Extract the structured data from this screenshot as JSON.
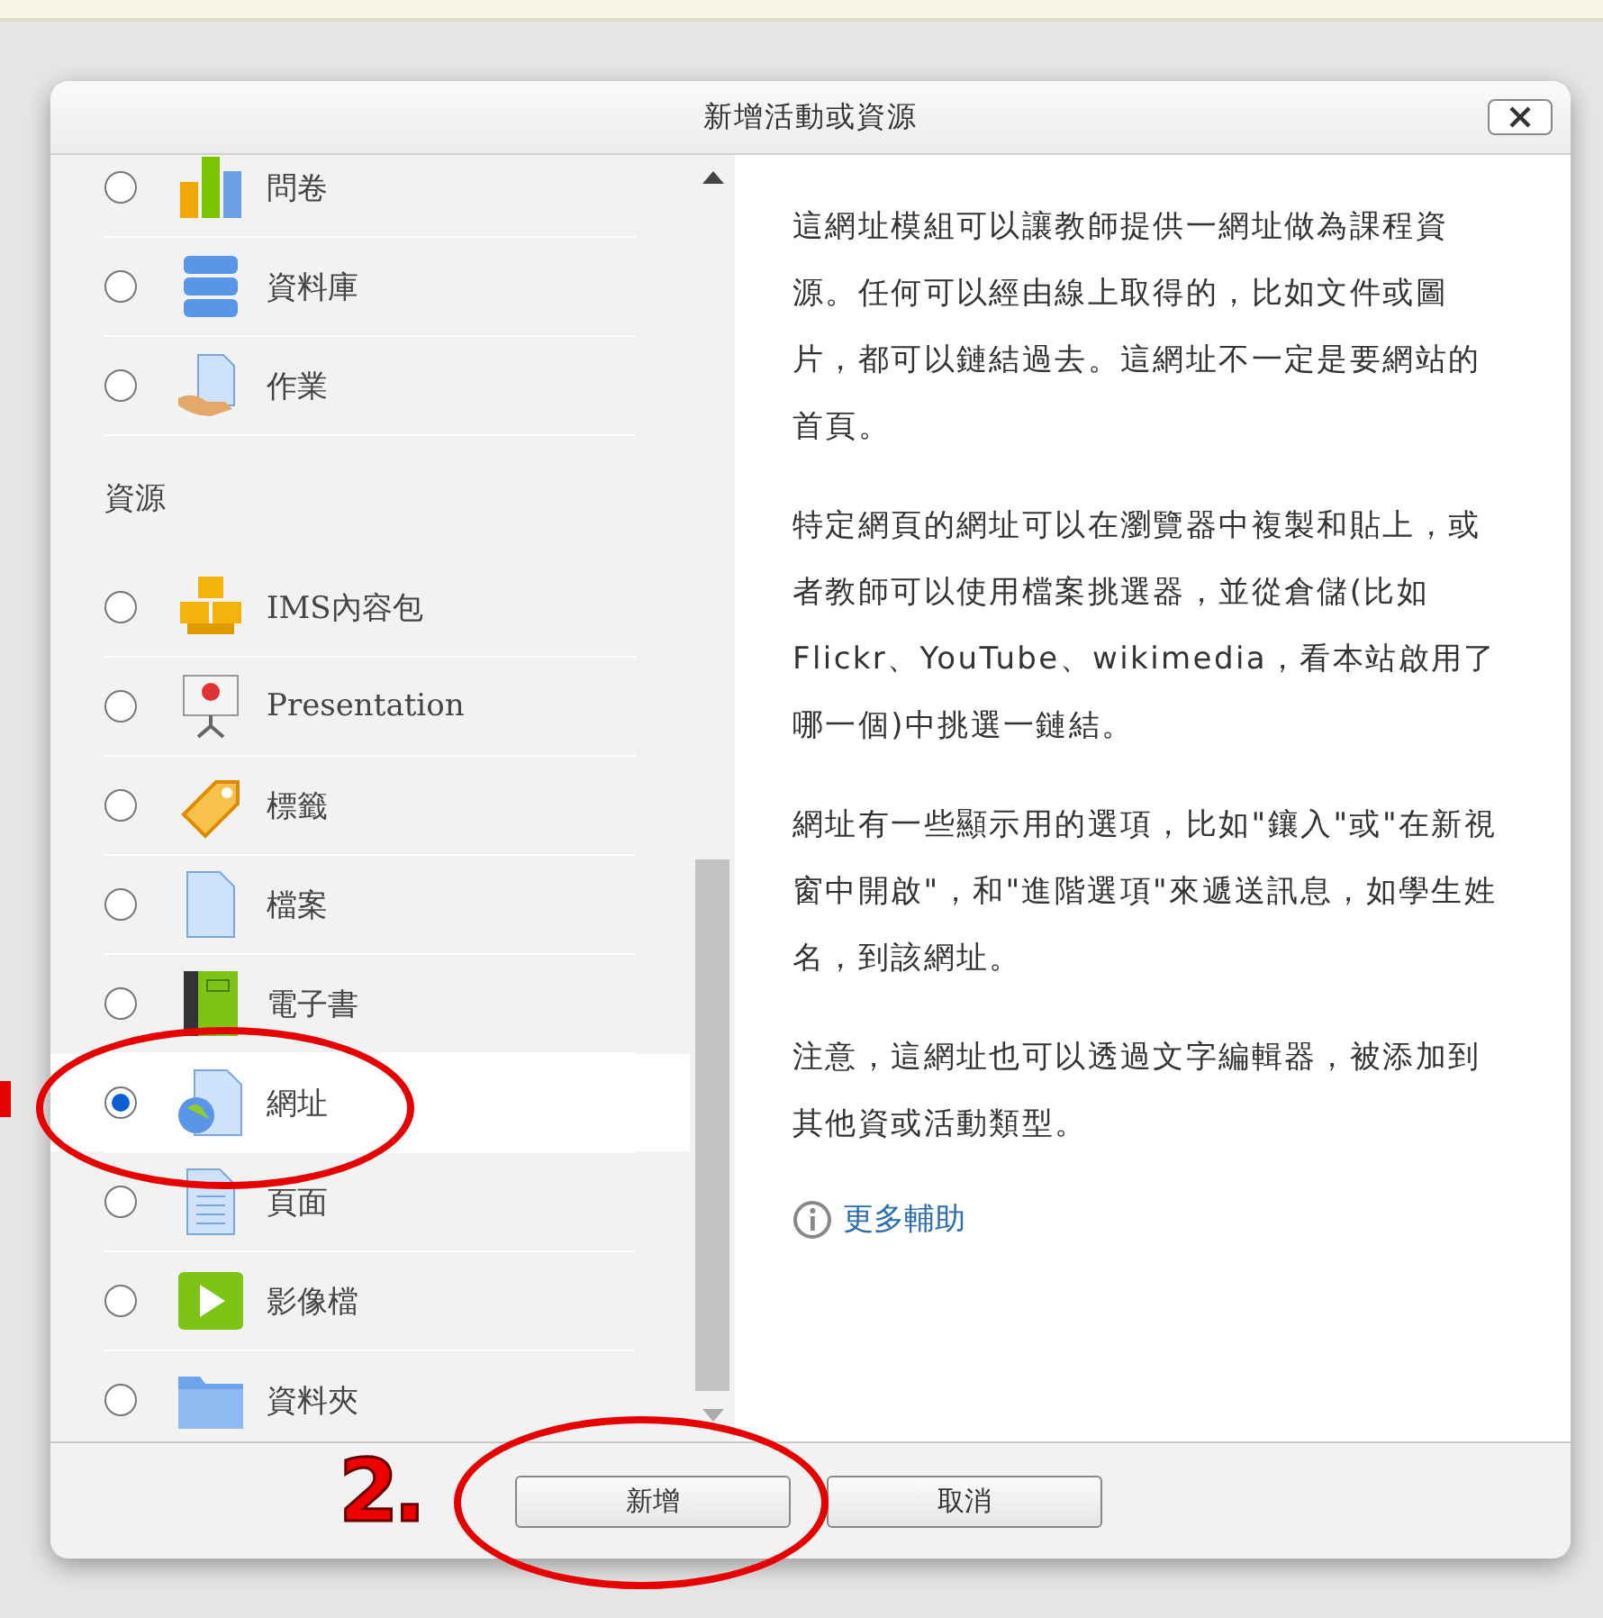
{
  "dialog": {
    "title": "新增活動或資源"
  },
  "sections": [
    {
      "items": [
        {
          "label": "問卷",
          "selected": false
        },
        {
          "label": "資料庫",
          "selected": false
        },
        {
          "label": "作業",
          "selected": false
        }
      ]
    },
    {
      "heading": "資源",
      "items": [
        {
          "label": "IMS內容包",
          "selected": false
        },
        {
          "label": "Presentation",
          "selected": false
        },
        {
          "label": "標籤",
          "selected": false
        },
        {
          "label": "檔案",
          "selected": false
        },
        {
          "label": "電子書",
          "selected": false
        },
        {
          "label": "網址",
          "selected": true
        },
        {
          "label": "頁面",
          "selected": false
        },
        {
          "label": "影像檔",
          "selected": false
        },
        {
          "label": "資料夾",
          "selected": false
        }
      ]
    }
  ],
  "description": {
    "paragraphs": [
      "這網址模組可以讓教師提供一網址做為課程資源。任何可以經由線上取得的，比如文件或圖片，都可以鏈結過去。這網址不一定是要網站的首頁。",
      "特定網頁的網址可以在瀏覽器中複製和貼上，或者教師可以使用檔案挑選器，並從倉儲(比如Flickr、YouTube、wikimedia，看本站啟用了哪一個)中挑選一鏈結。",
      "網址有一些顯示用的選項，比如\"鑲入\"或\"在新視窗中開啟\"，和\"進階選項\"來遞送訊息，如學生姓名，到該網址。",
      "注意，這網址也可以透過文字編輯器，被添加到其他資或活動類型。"
    ],
    "help_link": "更多輔助"
  },
  "buttons": [
    {
      "label": "新增"
    },
    {
      "label": "取消"
    }
  ],
  "annotation": {
    "label": "2."
  }
}
